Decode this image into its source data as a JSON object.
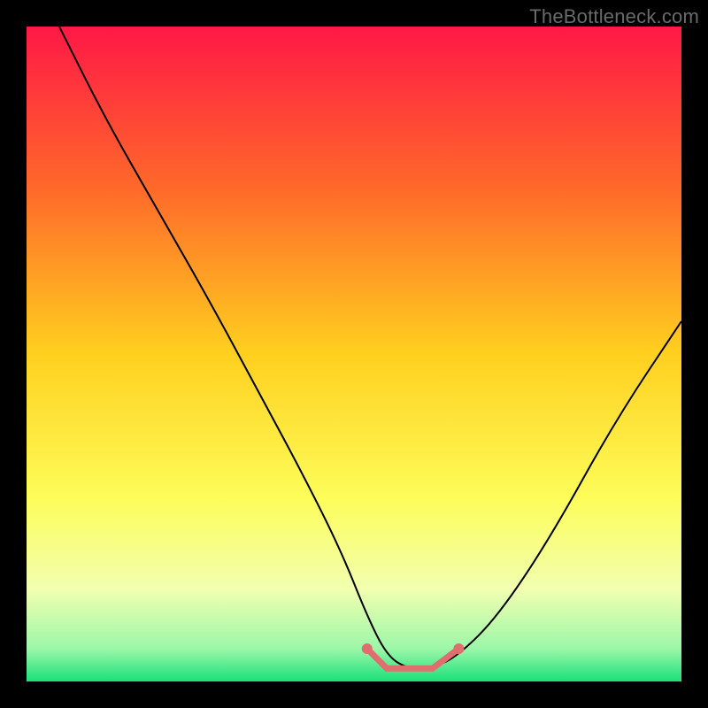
{
  "watermark": "TheBottleneck.com",
  "chart_data": {
    "type": "line",
    "title": "",
    "xlabel": "",
    "ylabel": "",
    "xlim": [
      0,
      100
    ],
    "ylim": [
      0,
      100
    ],
    "gradient_stops": [
      {
        "offset": 0,
        "color": "#ff1846"
      },
      {
        "offset": 25,
        "color": "#ff6a2a"
      },
      {
        "offset": 50,
        "color": "#ffd01f"
      },
      {
        "offset": 72,
        "color": "#fdfd5a"
      },
      {
        "offset": 86,
        "color": "#f1ffb0"
      },
      {
        "offset": 95,
        "color": "#9cf7a8"
      },
      {
        "offset": 100,
        "color": "#19e07b"
      }
    ],
    "series": [
      {
        "name": "bottleneck-curve",
        "color": "#000000",
        "x": [
          5,
          12,
          20,
          28,
          35,
          42,
          48,
          52,
          55,
          58,
          62,
          66,
          72,
          80,
          90,
          100
        ],
        "y": [
          100,
          86,
          72,
          58,
          45,
          32,
          20,
          10,
          4,
          2,
          2,
          4,
          10,
          22,
          40,
          55
        ]
      }
    ],
    "flat_highlight": {
      "name": "optimal-range",
      "color": "#e06e6e",
      "x": [
        52,
        55,
        58,
        62,
        66
      ],
      "y": [
        5,
        2,
        2,
        2,
        5
      ],
      "dot_radius": 6
    }
  }
}
